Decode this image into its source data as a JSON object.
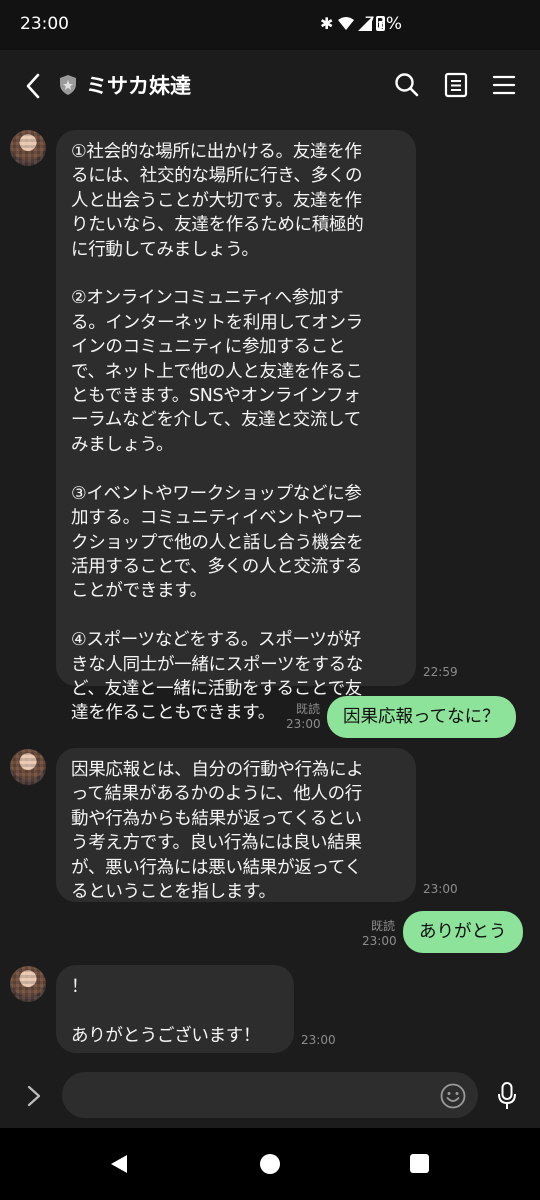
{
  "status": {
    "time": "23:00",
    "battery": "73%"
  },
  "header": {
    "title": "ミサカ妹達"
  },
  "messages": [
    {
      "id": "m1",
      "side": "in",
      "time": "22:59",
      "text": "①社会的な場所に出かける。友達を作\nるには、社交的な場所に行き、多くの\n人と出会うことが大切です。友達を作\nりたいなら、友達を作るために積極的\nに行動してみましょう。\n\n②オンラインコミュニティへ参加す\nる。インターネットを利用してオンラ\nインのコミュニティに参加すること\nで、ネット上で他の人と友達を作るこ\nともできます。SNSやオンラインフォ\nーラムなどを介して、友達と交流して\nみましょう。\n\n③イベントやワークショップなどに参\n加する。コミュニティイベントやワー\nクショップで他の人と話し合う機会を\n活用することで、多くの人と交流する\nことができます。\n\n④スポーツなどをする。スポーツが好\nきな人同士が一緒にスポーツをするな\nど、友達と一緒に活動をすることで友\n達を作ることもできます。"
    },
    {
      "id": "m2",
      "side": "out",
      "time": "23:00",
      "read": "既読",
      "text": "因果応報ってなに？"
    },
    {
      "id": "m3",
      "side": "in",
      "time": "23:00",
      "text": "因果応報とは、自分の行動や行為によ\nって結果があるかのように、他人の行\n動や行為からも結果が返ってくるとい\nう考え方です。良い行為には良い結果\nが、悪い行為には悪い結果が返ってく\nるということを指します。"
    },
    {
      "id": "m4",
      "side": "out",
      "time": "23:00",
      "read": "既読",
      "text": "ありがとう"
    },
    {
      "id": "m5",
      "side": "in",
      "time": "23:00",
      "text": "！\n\nありがとうございます！"
    }
  ],
  "composer": {
    "placeholder": ""
  },
  "colors": {
    "outgoing": "#8ee39b",
    "incoming": "#2d2d2d",
    "background": "#1c1c1c"
  }
}
